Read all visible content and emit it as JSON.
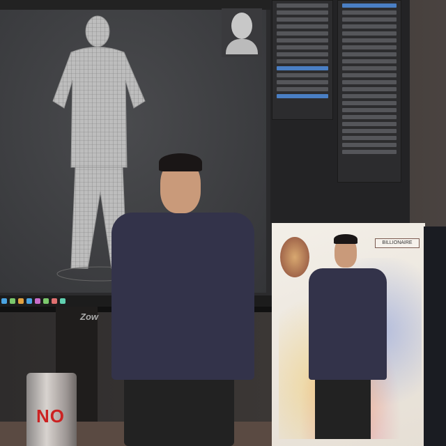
{
  "scene": {
    "description_tags": [
      "monitor",
      "3d-software",
      "person",
      "product-box",
      "can"
    ]
  },
  "monitor": {
    "brand": "Zow"
  },
  "can": {
    "text": "NO"
  },
  "box": {
    "label": "BILLIONAIRE"
  },
  "colors": {
    "hoodie": "#33334a",
    "selection": "#4a7fc4",
    "can_text": "#cc2222"
  }
}
